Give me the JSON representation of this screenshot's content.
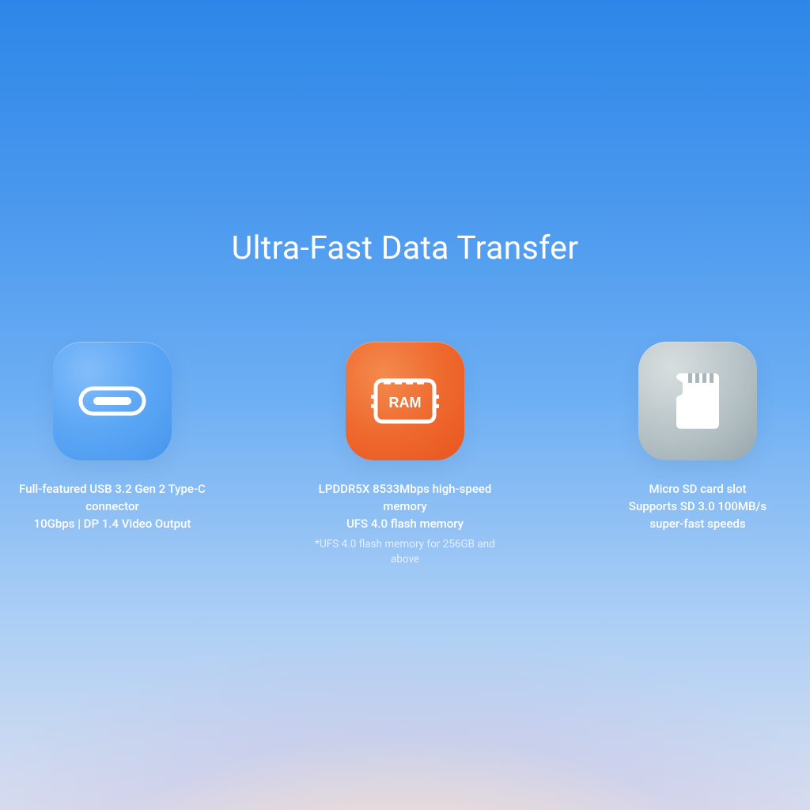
{
  "title": "Ultra-Fast Data Transfer",
  "features": {
    "usb": {
      "icon_name": "usb-c-icon",
      "line1": "Full-featured USB 3.2 Gen 2 Type-C connector",
      "line2": "10Gbps  |  DP 1.4 Video Output"
    },
    "ram": {
      "icon_name": "ram-icon",
      "line1": "LPDDR5X 8533Mbps high-speed memory",
      "line2": "UFS 4.0 flash memory",
      "footnote": "*UFS 4.0 flash memory for 256GB and above",
      "chip_label": "RAM"
    },
    "sd": {
      "icon_name": "micro-sd-icon",
      "line1": "Micro SD card slot",
      "line2": "Supports SD 3.0 100MB/s",
      "line3": "super-fast speeds"
    }
  }
}
